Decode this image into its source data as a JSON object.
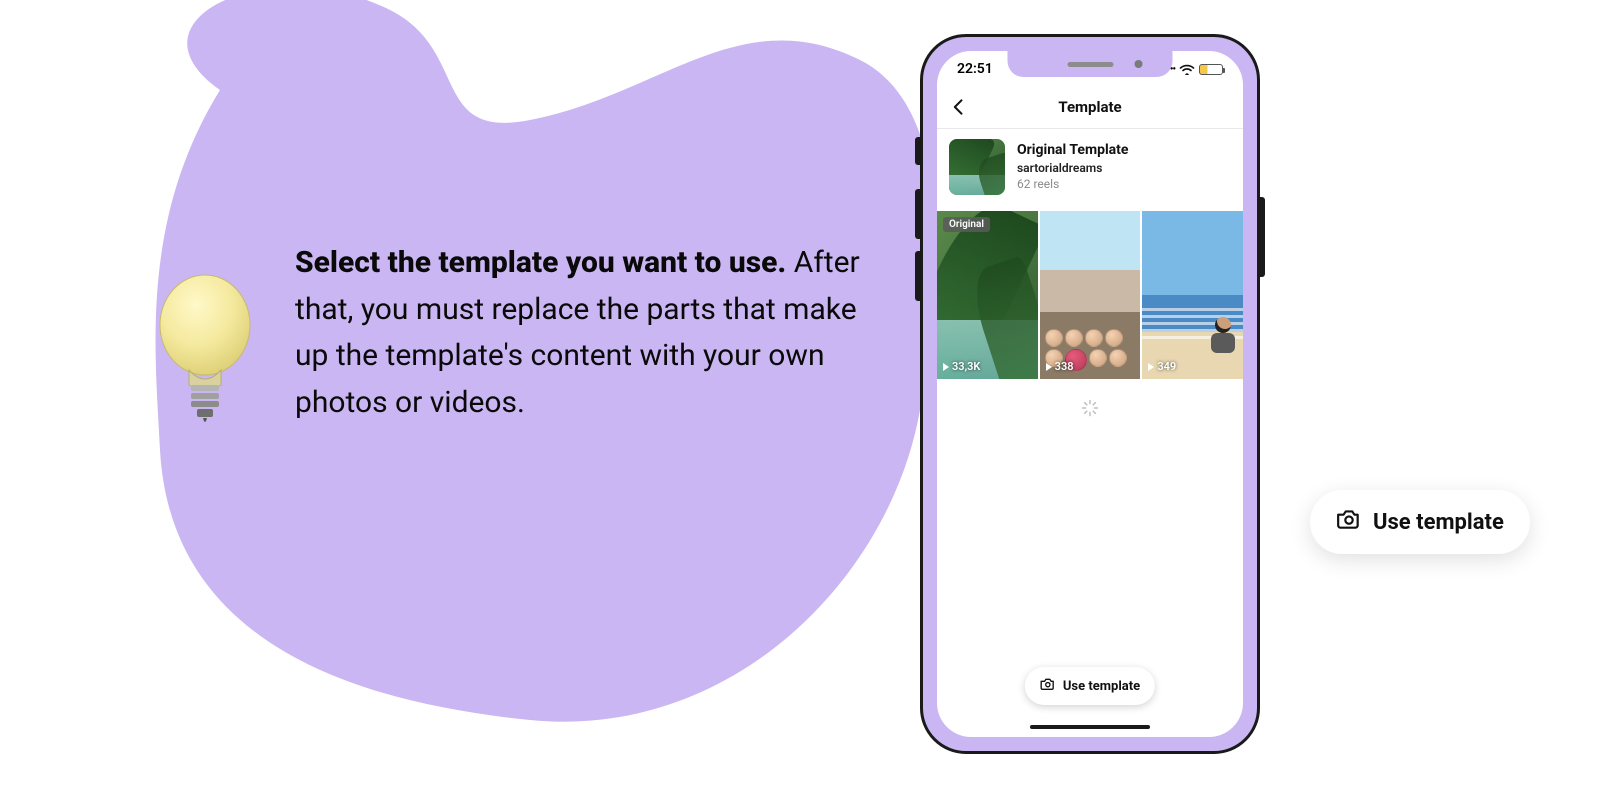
{
  "instruction": {
    "bold": "Select the template you want to use.",
    "rest": " After that, you must replace the parts that make up the template's content with your own photos or videos."
  },
  "phone": {
    "status": {
      "time": "22:51"
    },
    "header": {
      "title": "Template"
    },
    "template": {
      "title": "Original Template",
      "author": "sartorialdreams",
      "count": "62 reels"
    },
    "reels": [
      {
        "badge": "Original",
        "plays": "33,3K"
      },
      {
        "badge": "",
        "plays": "338"
      },
      {
        "badge": "",
        "plays": "349"
      }
    ],
    "cta": "Use template"
  },
  "pill": {
    "label": "Use template"
  },
  "colors": {
    "purple": "#c9b6f2"
  }
}
